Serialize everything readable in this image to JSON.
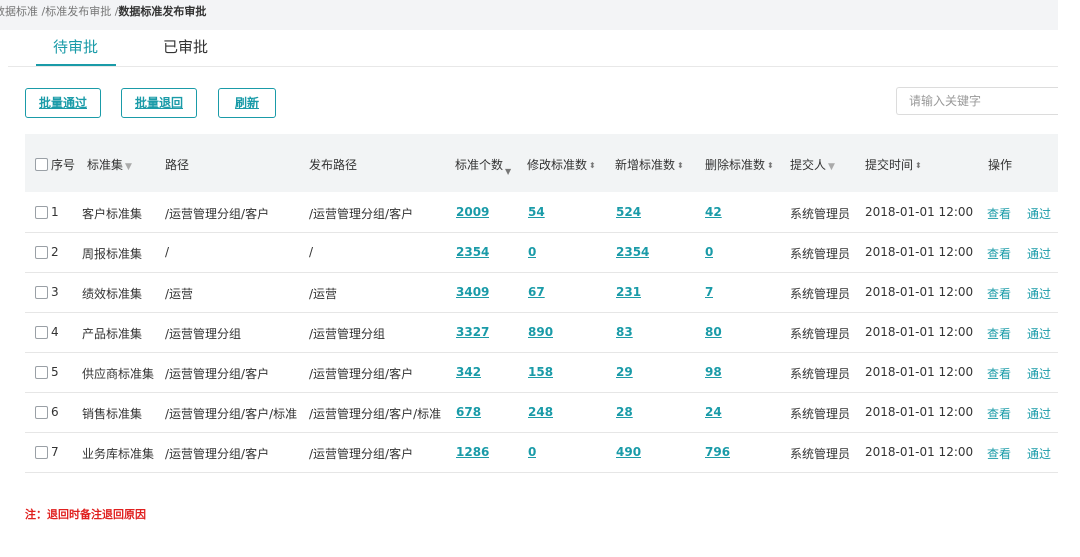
{
  "breadcrumb": {
    "item1": "数据标准 / ",
    "item2": "标准发布审批 / ",
    "current": "数据标准发布审批"
  },
  "tabs": [
    {
      "label": "待审批"
    },
    {
      "label": "已审批"
    }
  ],
  "toolbar": {
    "approve_all": "批量通过",
    "return_all": "批量退回",
    "refresh": "刷新"
  },
  "search": {
    "placeholder": "请输入关键字"
  },
  "columns": {
    "seq": "序号",
    "set": "标准集",
    "path": "路径",
    "publish_path": "发布路径",
    "count": "标准个数",
    "modified": "修改标准数",
    "added": "新增标准数",
    "deleted": "删除标准数",
    "submitter": "提交人",
    "time": "提交时间",
    "actions": "操作"
  },
  "rows": [
    {
      "seq": "1",
      "set": "客户标准集",
      "path": "/运营管理分组/客户",
      "publish_path": "/运营管理分组/客户",
      "count": "2009",
      "modified": "54",
      "added": "524",
      "deleted": "42",
      "submitter": "系统管理员",
      "time": "2018-01-01 12:00",
      "view": "查看",
      "approve": "通过"
    },
    {
      "seq": "2",
      "set": "周报标准集",
      "path": "/",
      "publish_path": "/",
      "count": "2354",
      "modified": "0",
      "added": "2354",
      "deleted": "0",
      "submitter": "系统管理员",
      "time": "2018-01-01 12:00",
      "view": "查看",
      "approve": "通过"
    },
    {
      "seq": "3",
      "set": "绩效标准集",
      "path": "/运营",
      "publish_path": "/运营",
      "count": "3409",
      "modified": "67",
      "added": "231",
      "deleted": "7",
      "submitter": "系统管理员",
      "time": "2018-01-01 12:00",
      "view": "查看",
      "approve": "通过"
    },
    {
      "seq": "4",
      "set": "产品标准集",
      "path": "/运营管理分组",
      "publish_path": "/运营管理分组",
      "count": "3327",
      "modified": "890",
      "added": "83",
      "deleted": "80",
      "submitter": "系统管理员",
      "time": "2018-01-01 12:00",
      "view": "查看",
      "approve": "通过"
    },
    {
      "seq": "5",
      "set": "供应商标准集",
      "path": "/运营管理分组/客户",
      "publish_path": "/运营管理分组/客户",
      "count": "342",
      "modified": "158",
      "added": "29",
      "deleted": "98",
      "submitter": "系统管理员",
      "time": "2018-01-01 12:00",
      "view": "查看",
      "approve": "通过"
    },
    {
      "seq": "6",
      "set": "销售标准集",
      "path": "/运营管理分组/客户/标准",
      "publish_path": "/运营管理分组/客户/标准",
      "count": "678",
      "modified": "248",
      "added": "28",
      "deleted": "24",
      "submitter": "系统管理员",
      "time": "2018-01-01 12:00",
      "view": "查看",
      "approve": "通过"
    },
    {
      "seq": "7",
      "set": "业务库标准集",
      "path": "/运营管理分组/客户",
      "publish_path": "/运营管理分组/客户",
      "count": "1286",
      "modified": "0",
      "added": "490",
      "deleted": "796",
      "submitter": "系统管理员",
      "time": "2018-01-01 12:00",
      "view": "查看",
      "approve": "通过"
    }
  ],
  "note": "注：退回时备注退回原因"
}
